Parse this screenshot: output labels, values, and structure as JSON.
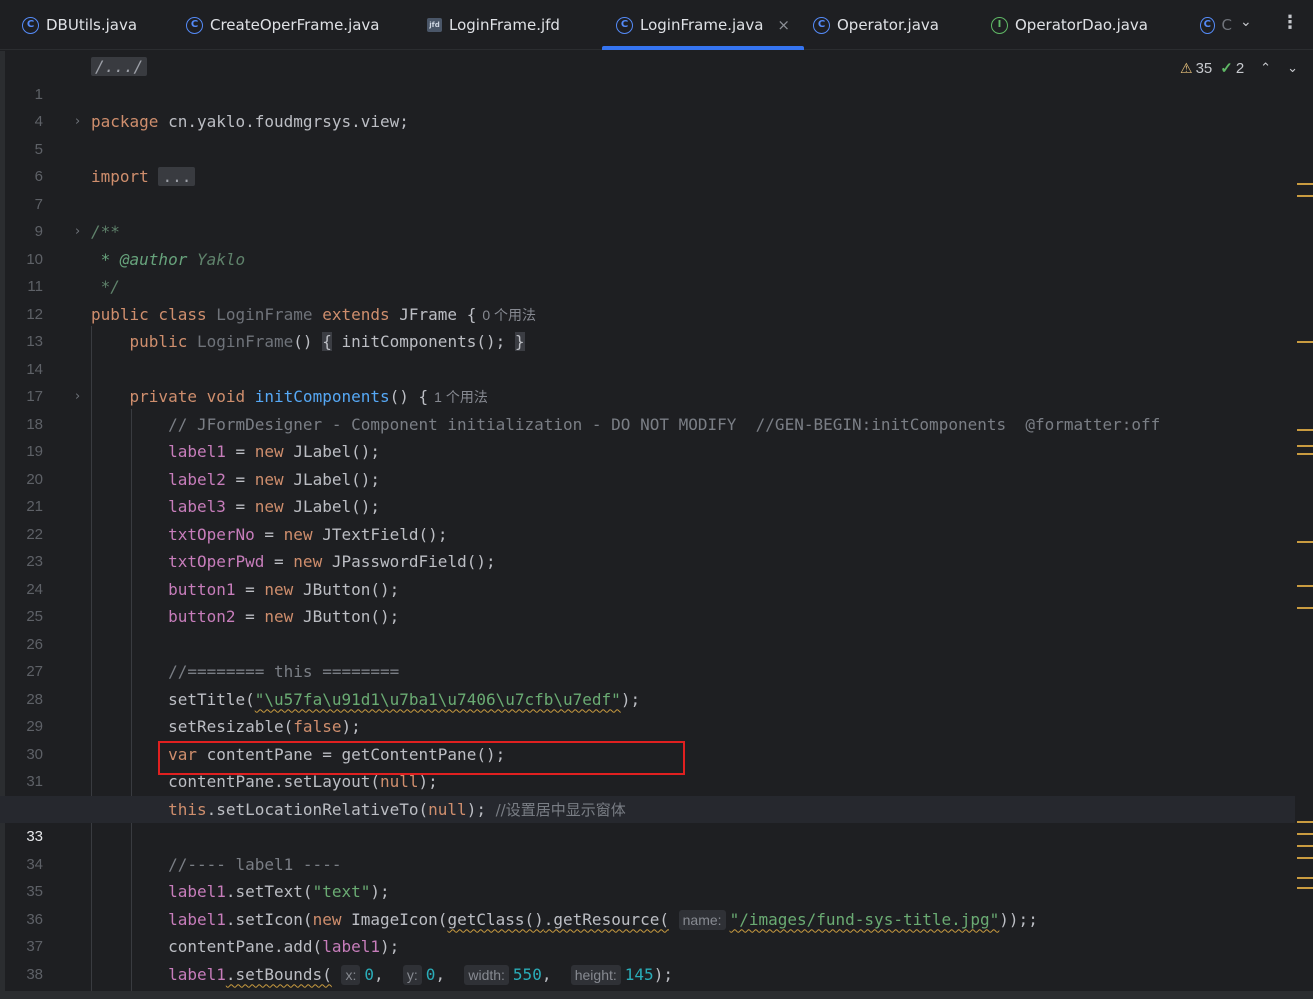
{
  "tabs": [
    {
      "label": "DBUtils.java",
      "icon": "C",
      "icon_name": "java-class-icon",
      "active": false
    },
    {
      "label": "CreateOperFrame.java",
      "icon": "C",
      "icon_name": "java-class-icon",
      "active": false
    },
    {
      "label": "LoginFrame.jfd",
      "icon": "jfd",
      "icon_name": "form-file-icon",
      "active": false
    },
    {
      "label": "LoginFrame.java",
      "icon": "C",
      "icon_name": "java-class-icon",
      "active": true
    },
    {
      "label": "Operator.java",
      "icon": "C",
      "icon_name": "java-class-icon",
      "active": false
    },
    {
      "label": "OperatorDao.java",
      "icon": "I",
      "icon_name": "java-interface-icon",
      "active": false
    },
    {
      "label": "C",
      "icon": "C",
      "icon_name": "java-class-icon",
      "active": false
    }
  ],
  "tab_close": "×",
  "tab_overflow": "⌄",
  "tab_more": "⋮",
  "inspections": {
    "warnings": "35",
    "ok": "2",
    "warn_icon": "⚠",
    "ok_icon": "✓",
    "up": "⌃",
    "down": "⌄"
  },
  "line_numbers": [
    "1",
    "4",
    "5",
    "6",
    "7",
    "9",
    "10",
    "11",
    "12",
    "13",
    "14",
    "17",
    "18",
    "19",
    "20",
    "21",
    "22",
    "23",
    "24",
    "25",
    "26",
    "27",
    "28",
    "29",
    "30",
    "31",
    "32",
    "33",
    "34",
    "35",
    "36",
    "37",
    "38",
    "39"
  ],
  "current_line": "33",
  "usages": {
    "class": "0 个用法",
    "method": "1 个用法"
  },
  "hints": {
    "name": "name:",
    "x": "x:",
    "y": "y:",
    "width": "width:",
    "height": "height:"
  },
  "code": {
    "header_fold": "/.../",
    "package_kw": "package",
    "package_name": " cn.yaklo.foudmgrsys.view;",
    "import_kw": "import",
    "import_fold": "...",
    "doc_open": "/**",
    "doc_author_tag": " * @author",
    "doc_author": " Yaklo",
    "doc_close": " */",
    "class_decl": {
      "mod": "public class",
      "name": " LoginFrame ",
      "ext": "extends",
      "sup": " JFrame {"
    },
    "ctor": {
      "mod": "public",
      "name": " LoginFrame",
      "parens": "()",
      "open": "{",
      "body": " initComponents(); ",
      "close": "}"
    },
    "init_decl": {
      "mod": "private void",
      "name": "initComponents",
      "rest": "() {"
    },
    "jfd_comment": "// JFormDesigner - Component initialization - DO NOT MODIFY  //GEN-BEGIN:initComponents  @formatter:off",
    "decls": [
      {
        "field": "label1",
        "type": "JLabel();"
      },
      {
        "field": "label2",
        "type": "JLabel();"
      },
      {
        "field": "label3",
        "type": "JLabel();"
      },
      {
        "field": "txtOperNo",
        "type": "JTextField();"
      },
      {
        "field": "txtOperPwd",
        "type": "JPasswordField();"
      },
      {
        "field": "button1",
        "type": "JButton();"
      },
      {
        "field": "button2",
        "type": "JButton();"
      }
    ],
    "assign_new": " = new ",
    "this_comment": "//======== this ========",
    "set_title_call": "setTitle(",
    "set_title_arg": "\"\\u57fa\\u91d1\\u7ba1\\u7406\\u7cfb\\u7edf\"",
    "set_title_end": ");",
    "set_resizable": "setResizable(",
    "false_kw": "false",
    "close_paren": ");",
    "var_kw": "var",
    "content_pane_decl": " contentPane = getContentPane();",
    "set_layout": "contentPane.setLayout(",
    "null_kw": "null",
    "this_kw": "this",
    "set_location": ".setLocationRelativeTo(",
    "set_location_end": "); ",
    "center_comment": "//设置居中显示窗体",
    "label1_comment": "//---- label1 ----",
    "label1": "label1",
    "set_text": ".setText(",
    "text_str": "\"text\"",
    "set_icon": ".setIcon(",
    "new_kw": "new",
    "image_icon": " ImageIcon(",
    "get_class": "getClass()",
    "get_resource": ".getResource(",
    "resource_path": "\"/images/fund-sys-title.jpg\"",
    "icon_end": "));",
    "content_add": "contentPane.add(",
    "add_end": ");",
    "set_bounds": ".setBounds(",
    "bounds_x": "0",
    "bounds_y": "0",
    "bounds_w": "550",
    "bounds_h": "145",
    "comma": ", ",
    "semi_end": ");"
  }
}
